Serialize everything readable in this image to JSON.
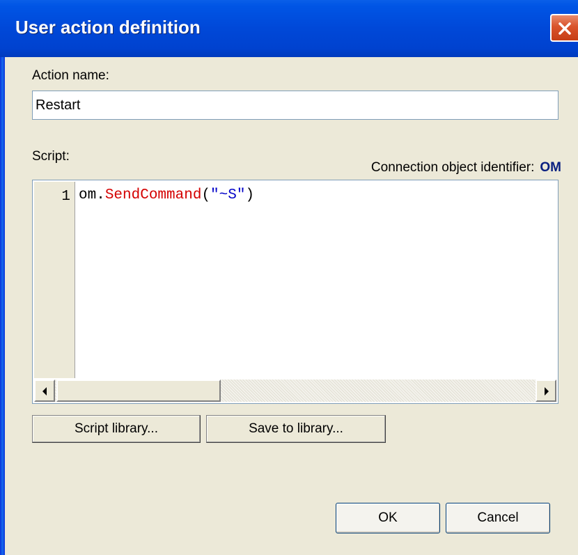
{
  "window": {
    "title": "User action definition"
  },
  "form": {
    "action_name_label": "Action name:",
    "action_name_value": "Restart",
    "script_label": "Script:",
    "connection_label": "Connection object identifier:",
    "connection_id": "OM"
  },
  "editor": {
    "line_number": "1",
    "code": {
      "object": "om.",
      "function": "SendCommand",
      "open": "(",
      "string": "\"~S\"",
      "close": ")"
    }
  },
  "buttons": {
    "script_library": "Script library...",
    "save_to_library": "Save to library...",
    "ok": "OK",
    "cancel": "Cancel"
  },
  "icons": {
    "close": "close-icon",
    "scroll_left": "arrow-left-icon",
    "scroll_right": "arrow-right-icon"
  },
  "colors": {
    "titlebar": "#0054e3",
    "close_button": "#d9532b",
    "dialog_bg": "#ece9d8",
    "code_function": "#d40000",
    "code_string": "#0000c8",
    "connection_id": "#0a2080"
  }
}
